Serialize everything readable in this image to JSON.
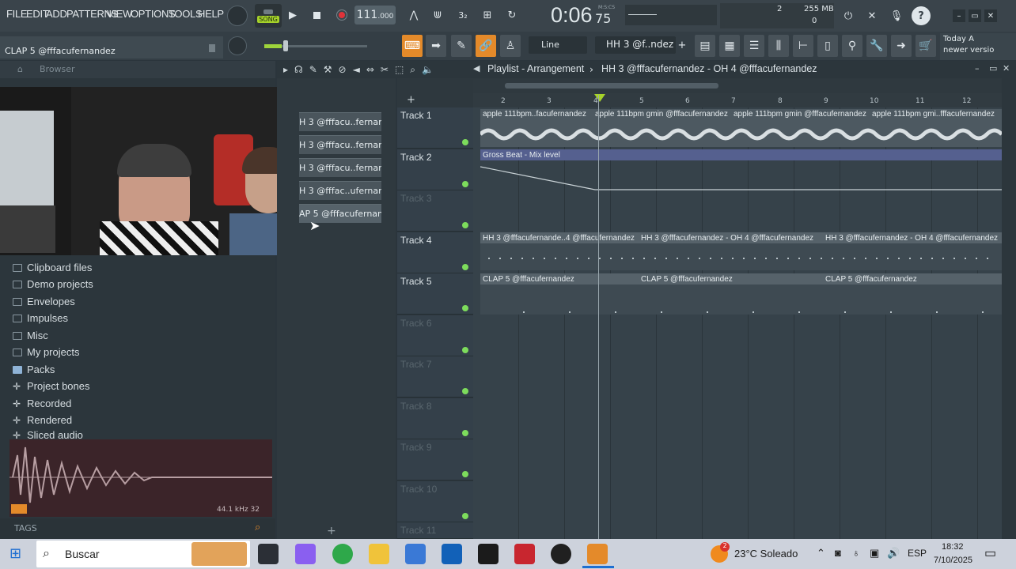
{
  "menu": [
    "FILE",
    "EDIT",
    "ADD",
    "PATTERNS",
    "VIEW",
    "OPTIONS",
    "TOOLS",
    "HELP"
  ],
  "transport": {
    "mode_label": "SONG",
    "tempo": "111",
    "tempo_decimals": ".000",
    "time": "0:06",
    "time_sub": "75",
    "time_units": "M:S:CS",
    "cpu_top": "2",
    "cpu_bottom": "0",
    "memory": "255 MB"
  },
  "hint_text": "CLAP 5 @fffacufernandez",
  "snap": "Line",
  "pattern_selector": "HH 3 @f..ndez",
  "news": {
    "line1": "Today  A",
    "line2": "newer versio"
  },
  "browser": {
    "header": "Browser",
    "items": [
      {
        "label": "Clipboard files",
        "icon": "folder-icon"
      },
      {
        "label": "Demo projects",
        "icon": "folder-icon"
      },
      {
        "label": "Envelopes",
        "icon": "folder-icon"
      },
      {
        "label": "Impulses",
        "icon": "folder-icon"
      },
      {
        "label": "Misc",
        "icon": "folder-icon"
      },
      {
        "label": "My projects",
        "icon": "folder-icon"
      },
      {
        "label": "Packs",
        "icon": "packs-icon"
      },
      {
        "label": "Project bones",
        "icon": "plus-icon"
      },
      {
        "label": "Recorded",
        "icon": "plus-icon"
      },
      {
        "label": "Rendered",
        "icon": "plus-icon"
      },
      {
        "label": "Sliced audio",
        "icon": "plus-icon"
      }
    ],
    "sample_info": "44.1 kHz 32",
    "tags_label": "TAGS"
  },
  "picker_items": [
    "H 3 @fffacu..fernandez",
    "H 3 @fffacu..fernandez",
    "H 3 @fffacu..fernandez",
    "H 3 @fffac..ufernandez",
    "AP 5 @fffacufernandez"
  ],
  "playlist": {
    "title": "Playlist - Arrangement",
    "pattern_path": "HH 3 @fffacufernandez - OH 4 @fffacufernandez",
    "ruler": [
      "2",
      "3",
      "4",
      "5",
      "6",
      "7",
      "8",
      "9",
      "10",
      "11",
      "12"
    ],
    "tracks": [
      "Track 1",
      "Track 2",
      "Track 3",
      "Track 4",
      "Track 5",
      "Track 6",
      "Track 7",
      "Track 8",
      "Track 9",
      "Track 10",
      "Track 11"
    ],
    "clips": {
      "t1": [
        "apple 111bpm..facufernandez",
        "apple 111bpm gmin @fffacufernandez",
        "apple 111bpm gmin @fffacufernandez",
        "apple 111bpm gmi..fffacufernandez"
      ],
      "t2": [
        "Gross Beat - Mix level"
      ],
      "t4": [
        "HH 3 @fffacufernande..4 @fffacufernandez",
        "HH 3 @fffacufernandez - OH 4 @fffacufernandez",
        "HH 3 @fffacufernandez - OH 4 @fffacufernandez"
      ],
      "t5": [
        "CLAP 5 @fffacufernandez",
        "CLAP 5 @fffacufernandez",
        "CLAP 5 @fffacufernandez"
      ]
    }
  },
  "taskbar": {
    "search": "Buscar",
    "weather": "23°C  Soleado",
    "lang": "ESP",
    "time": "18:32",
    "date": "7/10/2025",
    "notif_badge": "2"
  },
  "colors": {
    "accent_orange": "#e48a2a",
    "led_green": "#7ddc5c",
    "record_red": "#e0333a",
    "gross_beat": "#55608f"
  }
}
